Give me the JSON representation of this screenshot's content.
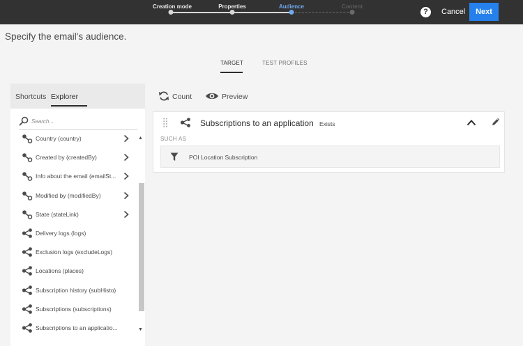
{
  "wizard": {
    "steps": [
      {
        "label": "Creation mode",
        "state": "done"
      },
      {
        "label": "Properties",
        "state": "done"
      },
      {
        "label": "Audience",
        "state": "active"
      },
      {
        "label": "Content",
        "state": "future"
      }
    ],
    "help_label": "?",
    "cancel_label": "Cancel",
    "next_label": "Next"
  },
  "page_title": "Specify the email's audience.",
  "tabs": [
    {
      "label": "TARGET",
      "active": true
    },
    {
      "label": "TEST PROFILES",
      "active": false
    }
  ],
  "left_panel": {
    "tabs": [
      {
        "label": "Shortcuts",
        "active": false
      },
      {
        "label": "Explorer",
        "active": true
      }
    ],
    "search_placeholder": "Search...",
    "items": [
      {
        "label": "Country (country)",
        "icon": "link-icon",
        "has_children": true
      },
      {
        "label": "Created by (createdBy)",
        "icon": "link-icon",
        "has_children": true
      },
      {
        "label": "Info about the email (emailSt...",
        "icon": "link-icon",
        "has_children": true
      },
      {
        "label": "Modified by (modifiedBy)",
        "icon": "link-icon",
        "has_children": true
      },
      {
        "label": "State (stateLink)",
        "icon": "link-icon",
        "has_children": true
      },
      {
        "label": "Delivery logs (logs)",
        "icon": "share-icon",
        "has_children": false
      },
      {
        "label": "Exclusion logs (excludeLogs)",
        "icon": "share-icon",
        "has_children": false
      },
      {
        "label": "Locations (places)",
        "icon": "share-icon",
        "has_children": false
      },
      {
        "label": "Subscription history (subHisto)",
        "icon": "share-icon",
        "has_children": false
      },
      {
        "label": "Subscriptions (subscriptions)",
        "icon": "share-icon",
        "has_children": false
      },
      {
        "label": "Subscriptions to an applicatio...",
        "icon": "share-icon",
        "has_children": false
      }
    ]
  },
  "toolbar": {
    "count_label": "Count",
    "preview_label": "Preview"
  },
  "rule": {
    "title": "Subscriptions to an application",
    "badge": "Exists",
    "such_as_label": "SUCH AS",
    "subrule_label": "POI Location Subscription"
  },
  "colors": {
    "topbar": "#323232",
    "accent": "#2680eb",
    "active_step": "#6fa9ee"
  }
}
